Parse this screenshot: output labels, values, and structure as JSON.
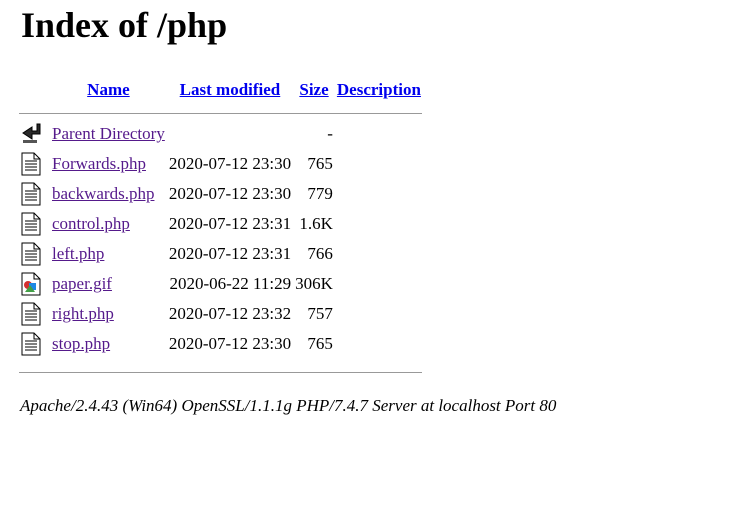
{
  "page": {
    "title": "Index of /php"
  },
  "columns": {
    "name": "Name",
    "last_modified": "Last modified",
    "size": "Size",
    "description": "Description"
  },
  "entries": [
    {
      "icon": "back-icon",
      "name": "Parent Directory",
      "modified": "",
      "size": "-",
      "description": ""
    },
    {
      "icon": "text-file-icon",
      "name": "Forwards.php",
      "modified": "2020-07-12 23:30",
      "size": "765",
      "description": ""
    },
    {
      "icon": "text-file-icon",
      "name": "backwards.php",
      "modified": "2020-07-12 23:30",
      "size": "779",
      "description": ""
    },
    {
      "icon": "text-file-icon",
      "name": "control.php",
      "modified": "2020-07-12 23:31",
      "size": "1.6K",
      "description": ""
    },
    {
      "icon": "text-file-icon",
      "name": "left.php",
      "modified": "2020-07-12 23:31",
      "size": "766",
      "description": ""
    },
    {
      "icon": "image-file-icon",
      "name": "paper.gif",
      "modified": "2020-06-22 11:29",
      "size": "306K",
      "description": ""
    },
    {
      "icon": "text-file-icon",
      "name": "right.php",
      "modified": "2020-07-12 23:32",
      "size": "757",
      "description": ""
    },
    {
      "icon": "text-file-icon",
      "name": "stop.php",
      "modified": "2020-07-12 23:30",
      "size": "765",
      "description": ""
    }
  ],
  "footer": {
    "server_signature": "Apache/2.4.43 (Win64) OpenSSL/1.1.1g PHP/7.4.7 Server at localhost Port 80"
  }
}
